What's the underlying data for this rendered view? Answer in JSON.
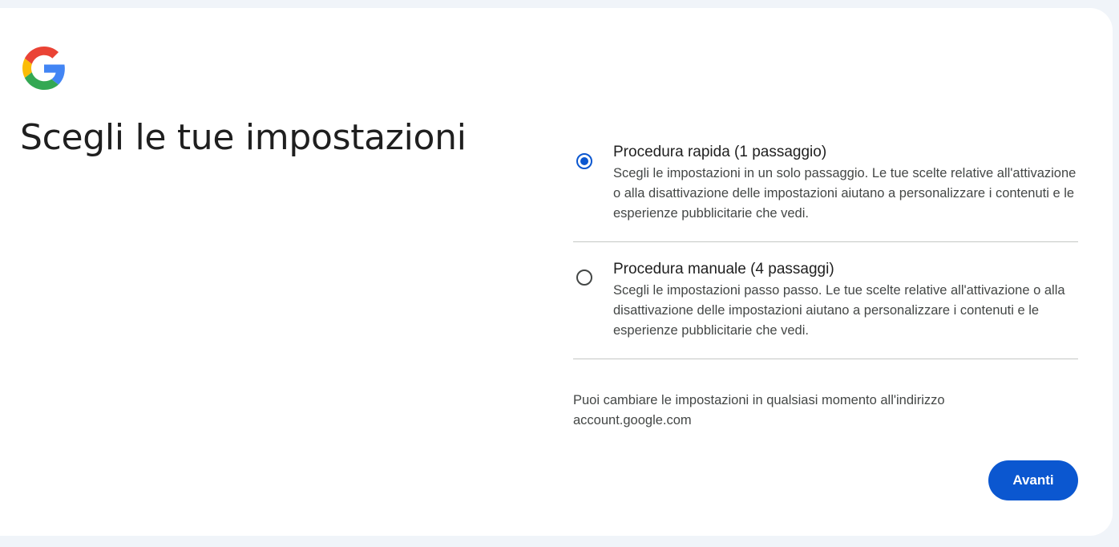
{
  "header": {
    "logo_icon": "google-g-logo",
    "title": "Scegli le tue impostazioni"
  },
  "options": [
    {
      "title": "Procedura rapida (1 passaggio)",
      "description": "Scegli le impostazioni in un solo passaggio. Le tue scelte relative all'attivazione o alla disattivazione delle impostazioni aiutano a personalizzare i contenuti e le esperienze pubblicitarie che vedi.",
      "selected": true
    },
    {
      "title": "Procedura manuale (4 passaggi)",
      "description": "Scegli le impostazioni passo passo. Le tue scelte relative all'attivazione o alla disattivazione delle impostazioni aiutano a personalizzare i contenuti e le esperienze pubblicitarie che vedi.",
      "selected": false
    }
  ],
  "note": "Puoi cambiare le impostazioni in qualsiasi momento all'indirizzo account.google.com",
  "next_button_label": "Avanti",
  "colors": {
    "accent": "#0b57d0",
    "background": "#f0f4f9",
    "card": "#ffffff",
    "divider": "#c4c7c5"
  }
}
